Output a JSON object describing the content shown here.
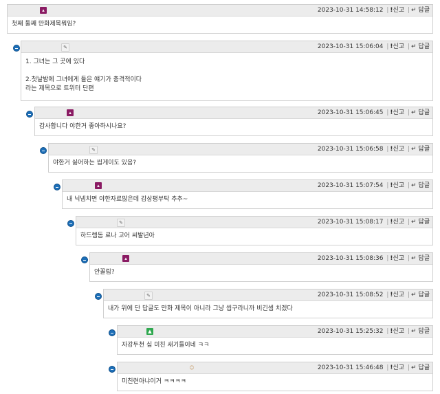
{
  "actions": {
    "report": "신고",
    "reply": "답글",
    "separator": "|"
  },
  "comments": [
    {
      "timestamp": "2023-10-31 14:58:12",
      "lines": [
        "첫째 둘째 만화제목뭐임?"
      ]
    },
    {
      "timestamp": "2023-10-31 15:06:04",
      "lines": [
        "1. 그녀는 그 곳에 있다",
        "",
        "2.첫날밤에 그녀에게 들은 얘기가 충격적이다",
        "라는 제목으로 트위터 단편"
      ]
    },
    {
      "timestamp": "2023-10-31 15:06:45",
      "lines": [
        "감사합니다 야한거 좋아하시나요?"
      ]
    },
    {
      "timestamp": "2023-10-31 15:06:58",
      "lines": [
        "야한거 싫어하는 씹게이도 있음?"
      ]
    },
    {
      "timestamp": "2023-10-31 15:07:54",
      "lines": [
        "내 닉넴치면 야한자료많은데 감상평부탁 추추~"
      ]
    },
    {
      "timestamp": "2023-10-31 15:08:17",
      "lines": [
        "하드렘돔 료나 고어 씨발년아"
      ]
    },
    {
      "timestamp": "2023-10-31 15:08:36",
      "lines": [
        "안꼴림?"
      ]
    },
    {
      "timestamp": "2023-10-31 15:08:52",
      "lines": [
        "내가 위에 단 답글도 만화 제목이 아니라 그냥 씹구라니까 비긴셈 치겠다"
      ]
    },
    {
      "timestamp": "2023-10-31 15:25:32",
      "lines": [
        "자강두천 십 미친 새기들이네 ㅋㅋ"
      ]
    },
    {
      "timestamp": "2023-10-31 15:46:48",
      "lines": [
        "미친련아냐이거 ㅋㅋㅋㅋ"
      ]
    }
  ]
}
